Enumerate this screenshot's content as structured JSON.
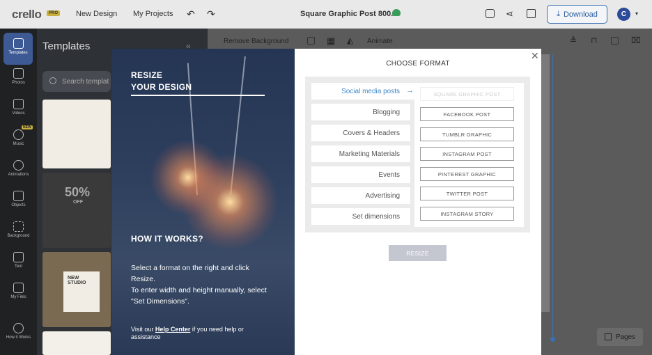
{
  "topbar": {
    "logo": "crello",
    "pro_badge": "PRO",
    "new_design": "New Design",
    "my_projects": "My Projects",
    "doc_title": "Square Graphic Post 800...",
    "download": "Download",
    "avatar_letter": "C"
  },
  "sidebar": {
    "items": [
      {
        "label": "Templates"
      },
      {
        "label": "Photos"
      },
      {
        "label": "Videos"
      },
      {
        "label": "Music",
        "badge": "NEW"
      },
      {
        "label": "Animations"
      },
      {
        "label": "Objects"
      },
      {
        "label": "Background"
      },
      {
        "label": "Text"
      },
      {
        "label": "My Files"
      },
      {
        "label": "How it Works"
      }
    ]
  },
  "panel": {
    "title": "Templates",
    "search_placeholder": "Search templat",
    "thumb2_text": "50%",
    "thumb2_sub": "OFF",
    "thumb3_text": "NEW STUDIO"
  },
  "toolbar": {
    "remove_bg": "Remove Background",
    "animate": "Animate"
  },
  "pages": "Pages",
  "modal": {
    "left": {
      "title_line1": "RESIZE",
      "title_line2": "YOUR DESIGN",
      "how_title": "HOW IT WORKS?",
      "how_text1": "Select a format on the right and click Resize.",
      "how_text2": "To enter width and height manually, select \"Set Dimensions\".",
      "foot_prefix": "Visit our ",
      "foot_link": "Help Center",
      "foot_suffix": " if you need help or assistance"
    },
    "right": {
      "title": "CHOOSE FORMAT",
      "categories": [
        "Social media posts",
        "Blogging",
        "Covers & Headers",
        "Marketing Materials",
        "Events",
        "Advertising",
        "Set dimensions"
      ],
      "options": [
        "SQUARE GRAPHIC POST",
        "FACEBOOK POST",
        "TUMBLR GRAPHIC",
        "INSTAGRAM POST",
        "PINTEREST GRAPHIC",
        "TWITTER POST",
        "INSTAGRAM STORY"
      ],
      "resize_button": "RESIZE"
    }
  },
  "colors": {
    "accent": "#3e89c7",
    "brand_blue": "#2a5da0",
    "sidebar_active": "#3d5a94"
  }
}
